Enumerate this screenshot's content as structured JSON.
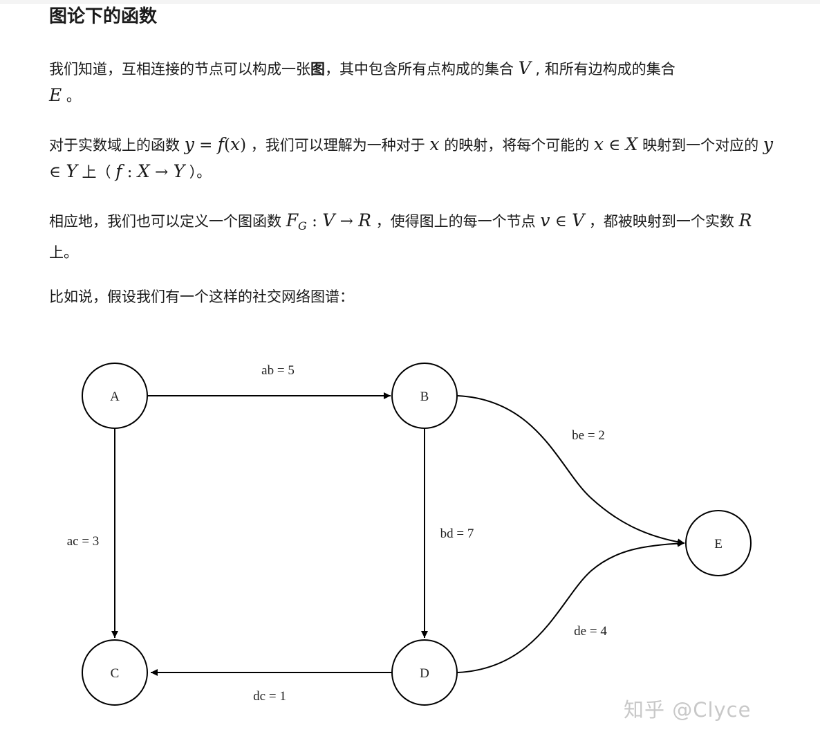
{
  "title": "图论下的函数",
  "p1": {
    "t1": "我们知道，互相连接的节点可以构成一张",
    "bold": "图",
    "t2": "，其中包含所有点构成的集合 ",
    "V": "V",
    "t3": " , 和所有边构成的集合",
    "E": "E",
    "t4": " 。"
  },
  "p2": {
    "t1": "对于实数域上的函数 ",
    "f1": "y",
    "f2": " = ",
    "f3": "f",
    "f4": "(",
    "f5": "x",
    "f6": ")",
    "t2": " ，我们可以理解为一种对于 ",
    "x": "x",
    "t3": " 的映射，将每个可能的 ",
    "x2": "x",
    "in1": " ∈ ",
    "X": "X",
    "t4": " 映射到一个对应的 ",
    "y": "y",
    "in2": " ∈ ",
    "Y": "Y",
    "t5": " 上（ ",
    "f": "f",
    "colon": " : ",
    "X2": "X",
    "arrow": " → ",
    "Y2": "Y",
    "t6": " ）。"
  },
  "p3": {
    "t1": "相应地，我们也可以定义一个图函数 ",
    "F": "F",
    "G": "G",
    "colon": " : ",
    "V": "V",
    "arrow": " → ",
    "R": "R",
    "t2": " ，使得图上的每一个节点 ",
    "v": "v",
    "in": " ∈ ",
    "V2": "V",
    "t3": " ，都被映射到一个实数 ",
    "R2": "R",
    "t4": " 上。"
  },
  "p4": "比如说，假设我们有一个这样的社交网络图谱：",
  "graph": {
    "nodes": [
      "A",
      "B",
      "C",
      "D",
      "E"
    ],
    "edges": {
      "ab": "ab = 5",
      "ac": "ac = 3",
      "bd": "bd = 7",
      "be": "be = 2",
      "dc": "dc = 1",
      "de": "de = 4"
    }
  },
  "watermark": "知乎 @Clyce",
  "colors": {
    "text": "#1a1a1a",
    "edge": "#000000",
    "watermark": "#c8c8c8"
  }
}
